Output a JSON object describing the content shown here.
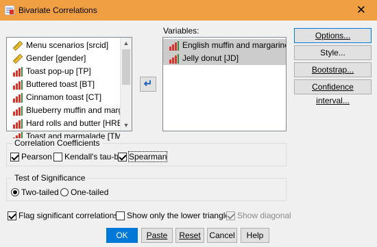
{
  "window": {
    "title": "Bivariate Correlations",
    "close_glyph": "✕"
  },
  "source_list": {
    "items": [
      {
        "label": "Menu scenarios [srcid]",
        "icon": "ruler-string-icon"
      },
      {
        "label": "Gender [gender]",
        "icon": "ruler-string-icon"
      },
      {
        "label": "Toast pop-up [TP]",
        "icon": "bar-scale-icon"
      },
      {
        "label": "Buttered toast [BT]",
        "icon": "bar-scale-icon"
      },
      {
        "label": "Cinnamon toast [CT]",
        "icon": "bar-scale-icon"
      },
      {
        "label": "Blueberry muffin and marg...",
        "icon": "bar-scale-icon"
      },
      {
        "label": "Hard rolls and butter [HRB]",
        "icon": "bar-scale-icon"
      },
      {
        "label": "Toast and marmalade [TMd]",
        "icon": "bar-scale-icon"
      }
    ],
    "scroll_up_glyph": "▲",
    "scroll_down_glyph": "▼"
  },
  "move_button": {
    "glyph": "↵"
  },
  "variables": {
    "label": "Variables:",
    "items": [
      {
        "label": "English muffin and margarine...",
        "icon": "bar-scale-icon"
      },
      {
        "label": "Jelly donut [JD]",
        "icon": "bar-scale-icon"
      }
    ]
  },
  "side_buttons": {
    "options": "Options...",
    "style": "Style...",
    "bootstrap": "Bootstrap...",
    "confidence": "Confidence interval..."
  },
  "coefficients": {
    "title": "Correlation Coefficients",
    "pearson": {
      "label": "Pearson",
      "checked": true
    },
    "kendall": {
      "label": "Kendall's tau-b",
      "checked": false
    },
    "spearman": {
      "label": "Spearman",
      "checked": true
    }
  },
  "significance": {
    "title": "Test of Significance",
    "two_tailed": {
      "label": "Two-tailed",
      "selected": true
    },
    "one_tailed": {
      "label": "One-tailed",
      "selected": false
    }
  },
  "options_row": {
    "flag": {
      "label": "Flag significant correlations",
      "checked": true
    },
    "lower": {
      "label": "Show only the lower triangle",
      "checked": false
    },
    "diagonal": {
      "label": "Show diagonal",
      "checked": true,
      "disabled": true
    }
  },
  "footer": {
    "ok": "OK",
    "paste": "Paste",
    "reset": "Reset",
    "cancel": "Cancel",
    "help": "Help"
  },
  "colors": {
    "title_bar": "#f0a043",
    "accent": "#0078d7",
    "selection": "#cccccc"
  }
}
